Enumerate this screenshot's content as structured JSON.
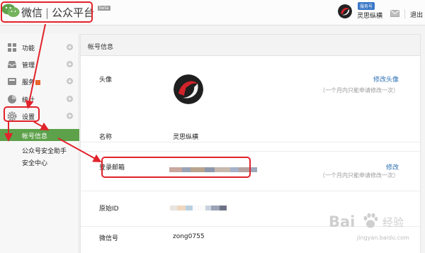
{
  "header": {
    "logo_main": "微信",
    "logo_sep": "|",
    "logo_sub": "公众平台",
    "beta_tag": "beta",
    "service_badge": "服务号",
    "account_name": "灵思纵横",
    "logout": "退出"
  },
  "sidebar": {
    "items": [
      {
        "label": "功能",
        "icon": "function-icon"
      },
      {
        "label": "管理",
        "icon": "inbox-icon"
      },
      {
        "label": "服务",
        "icon": "service-icon"
      },
      {
        "label": "统计",
        "icon": "stats-icon"
      },
      {
        "label": "设置",
        "icon": "gear-icon"
      }
    ],
    "sub_items": [
      {
        "label": "帐号信息",
        "active": true
      },
      {
        "label": "公众号安全助手",
        "active": false
      },
      {
        "label": "安全中心",
        "active": false
      }
    ]
  },
  "main": {
    "title": "帐号信息",
    "rows": {
      "avatar": {
        "label": "头像",
        "action": "修改头像",
        "note": "（一个月内只能申请修改一次）"
      },
      "name": {
        "label": "名称",
        "value": "灵思纵横"
      },
      "email": {
        "label": "登录邮箱",
        "action": "修改",
        "note": "（一个月内只能申请修改一次）"
      },
      "original_id": {
        "label": "原始ID"
      },
      "wechat_id": {
        "label": "微信号",
        "value": "zong0755"
      }
    }
  },
  "watermark": {
    "logo": "Bai",
    "brand": "经验",
    "url": "jingyan.baidu.com"
  },
  "colors": {
    "accent_green": "#5da14a",
    "annotation_red": "#e1232b",
    "link_blue": "#2b6fb6",
    "badge_blue": "#3a77c7"
  }
}
